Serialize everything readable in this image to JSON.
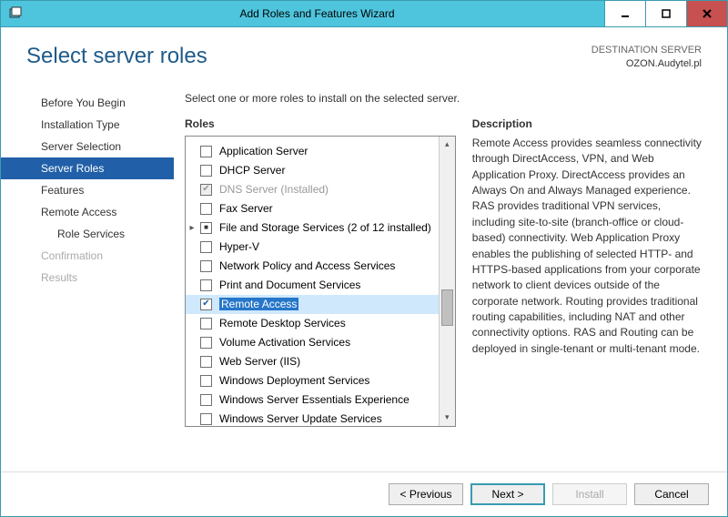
{
  "window": {
    "title": "Add Roles and Features Wizard"
  },
  "header": {
    "page_title": "Select server roles",
    "dest_label": "DESTINATION SERVER",
    "dest_value": "OZON.Audytel.pl"
  },
  "sidebar": {
    "items": [
      {
        "label": "Before You Begin",
        "state": "normal"
      },
      {
        "label": "Installation Type",
        "state": "normal"
      },
      {
        "label": "Server Selection",
        "state": "normal"
      },
      {
        "label": "Server Roles",
        "state": "active"
      },
      {
        "label": "Features",
        "state": "normal"
      },
      {
        "label": "Remote Access",
        "state": "normal"
      },
      {
        "label": "Role Services",
        "state": "sub"
      },
      {
        "label": "Confirmation",
        "state": "disabled"
      },
      {
        "label": "Results",
        "state": "disabled"
      }
    ]
  },
  "main": {
    "intro": "Select one or more roles to install on the selected server.",
    "roles_heading": "Roles",
    "desc_heading": "Description",
    "roles": [
      {
        "label": "Application Server",
        "check": "unchecked"
      },
      {
        "label": "DHCP Server",
        "check": "unchecked"
      },
      {
        "label": "DNS Server (Installed)",
        "check": "checked-disabled",
        "disabled": true
      },
      {
        "label": "Fax Server",
        "check": "unchecked"
      },
      {
        "label": "File and Storage Services (2 of 12 installed)",
        "check": "mixed",
        "expander": true
      },
      {
        "label": "Hyper-V",
        "check": "unchecked"
      },
      {
        "label": "Network Policy and Access Services",
        "check": "unchecked"
      },
      {
        "label": "Print and Document Services",
        "check": "unchecked"
      },
      {
        "label": "Remote Access",
        "check": "checked",
        "selected": true
      },
      {
        "label": "Remote Desktop Services",
        "check": "unchecked"
      },
      {
        "label": "Volume Activation Services",
        "check": "unchecked"
      },
      {
        "label": "Web Server (IIS)",
        "check": "unchecked"
      },
      {
        "label": "Windows Deployment Services",
        "check": "unchecked"
      },
      {
        "label": "Windows Server Essentials Experience",
        "check": "unchecked"
      },
      {
        "label": "Windows Server Update Services",
        "check": "unchecked"
      }
    ],
    "description": "Remote Access provides seamless connectivity through DirectAccess, VPN, and Web Application Proxy. DirectAccess provides an Always On and Always Managed experience. RAS provides traditional VPN services, including site-to-site (branch-office or cloud-based) connectivity. Web Application Proxy enables the publishing of selected HTTP- and HTTPS-based applications from your corporate network to client devices outside of the corporate network. Routing provides traditional routing capabilities, including NAT and other connectivity options. RAS and Routing can be deployed in single-tenant or multi-tenant mode."
  },
  "buttons": {
    "previous": "< Previous",
    "next": "Next >",
    "install": "Install",
    "cancel": "Cancel"
  }
}
